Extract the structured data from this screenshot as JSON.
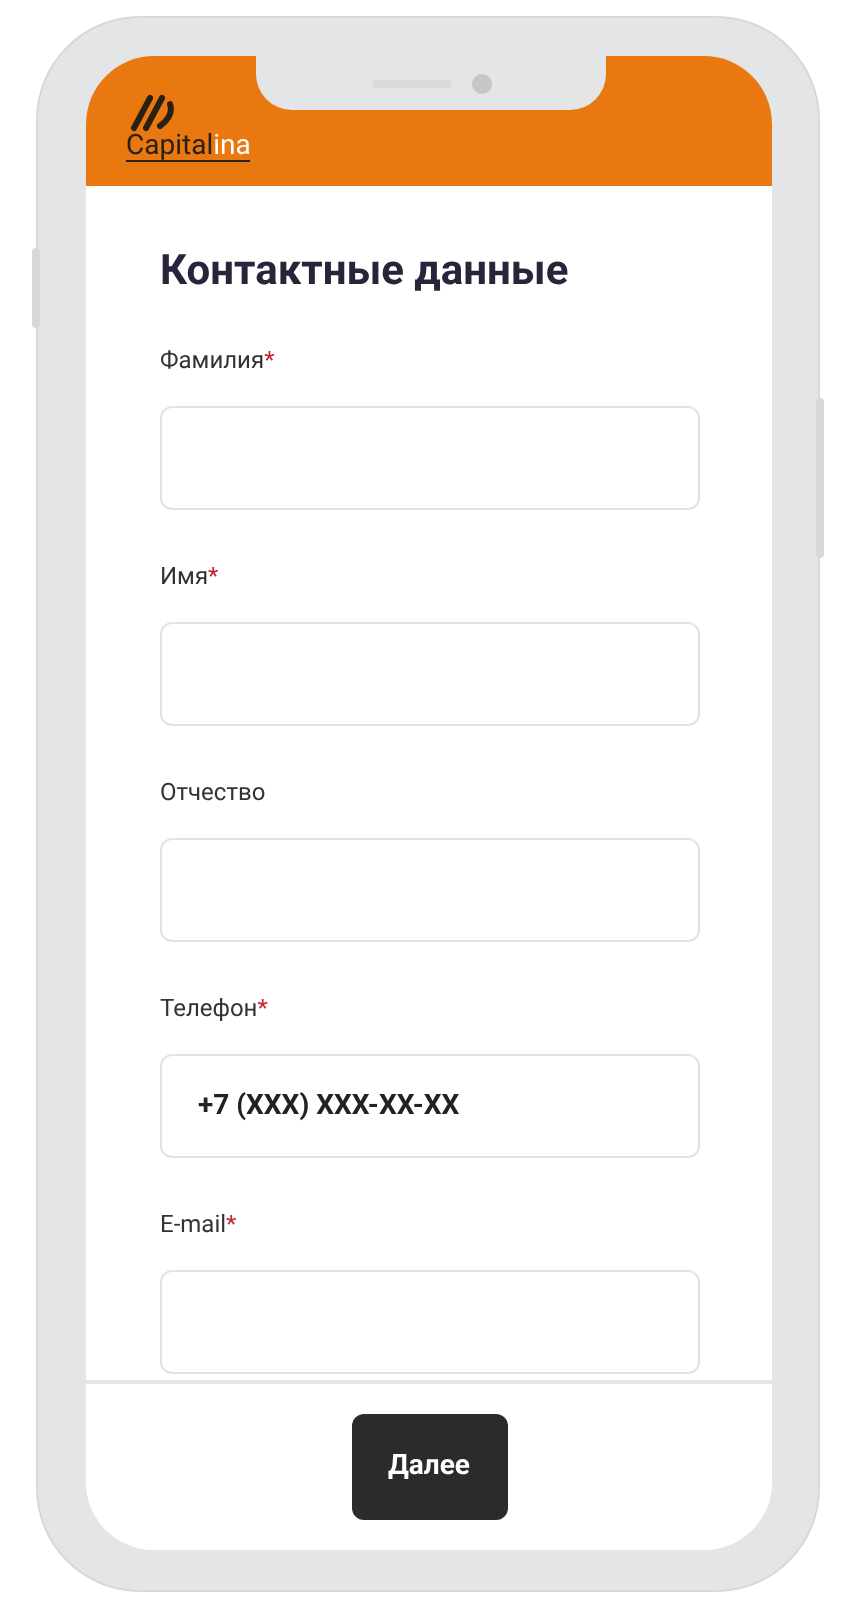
{
  "header": {
    "logo": {
      "text_dark": "Capital",
      "text_light": "ina"
    }
  },
  "form": {
    "title": "Контактные данные",
    "fields": [
      {
        "label": "Фамилия",
        "required_mark": "*"
      },
      {
        "label": "Имя",
        "required_mark": "*"
      },
      {
        "label": "Отчество"
      },
      {
        "label": "Телефон",
        "required_mark": "*",
        "value": "+7 (XXX) XXX-XX-XX"
      },
      {
        "label": "E-mail",
        "required_mark": "*"
      }
    ]
  },
  "footer": {
    "next_button": "Далее"
  }
}
